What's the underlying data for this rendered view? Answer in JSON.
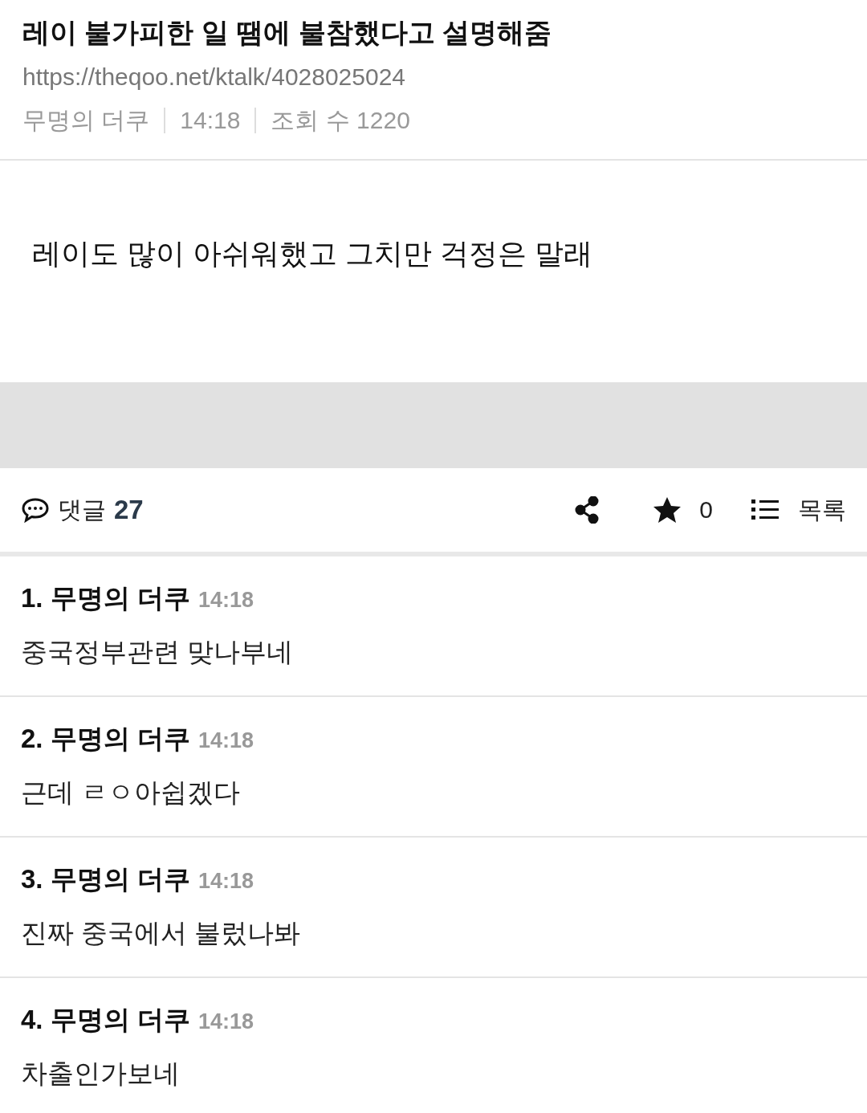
{
  "post": {
    "title": "레이 불가피한 일 땜에 불참했다고 설명해줌",
    "url": "https://theqoo.net/ktalk/4028025024",
    "meta": [
      "무명의 더쿠",
      "14:18",
      "조회 수 1220"
    ],
    "body": "레이도 많이 아쉬워했고 그치만 걱정은 말래"
  },
  "toolbar": {
    "comment_label": "댓글",
    "comment_count": "27",
    "star_count": "0",
    "list_label": "목록"
  },
  "comments": [
    {
      "number": "1.",
      "author": "무명의 더쿠",
      "time": "14:18",
      "text": "중국정부관련 맞나부네"
    },
    {
      "number": "2.",
      "author": "무명의 더쿠",
      "time": "14:18",
      "text": "근데 ㄹㅇ아쉽겠다"
    },
    {
      "number": "3.",
      "author": "무명의 더쿠",
      "time": "14:18",
      "text": "진짜 중국에서 불렀나봐"
    },
    {
      "number": "4.",
      "author": "무명의 더쿠",
      "time": "14:18",
      "text": "차출인가보네"
    }
  ]
}
